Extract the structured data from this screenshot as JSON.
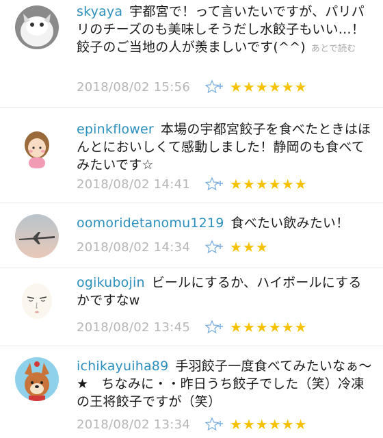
{
  "later_read_label": "あとで読む",
  "comments": [
    {
      "user": "skyaya",
      "text": "宇都宮で！って言いたいですが、パリパリのチーズのも美味しそうだし水餃子もいい…！餃子のご当地の人が羨ましいです(^^)",
      "time": "2018/08/02 15:56",
      "stars": "★★★★★★"
    },
    {
      "user": "epinkflower",
      "text": "本場の宇都宮餃子を食べたときはほんとにおいしくて感動しました！静岡のも食べてみたいです☆",
      "time": "2018/08/02 14:41",
      "stars": "★★★★★★"
    },
    {
      "user": "oomoridetanomu1219",
      "text": "食べたい飲みたい！",
      "time": "2018/08/02 14:34",
      "stars": "★★★"
    },
    {
      "user": "ogikubojin",
      "text": "ビールにするか、ハイボールにするかですなw",
      "time": "2018/08/02 13:45",
      "stars": "★★★★★★"
    },
    {
      "user": "ichikayuiha89",
      "text": "手羽餃子一度食べてみたいなぁ〜★　ちなみに・・昨日うち餃子でした（笑）冷凍の王将餃子ですが（笑）",
      "time": "2018/08/02 13:34",
      "stars": "★★★★★★"
    }
  ],
  "colors": {
    "username": "#2b8fbd",
    "star": "#f6c200",
    "timestamp": "#b6b6b6",
    "fav_icon": "#7aaee0"
  },
  "icons": [
    "add-star-icon",
    "rating-star-icon"
  ]
}
